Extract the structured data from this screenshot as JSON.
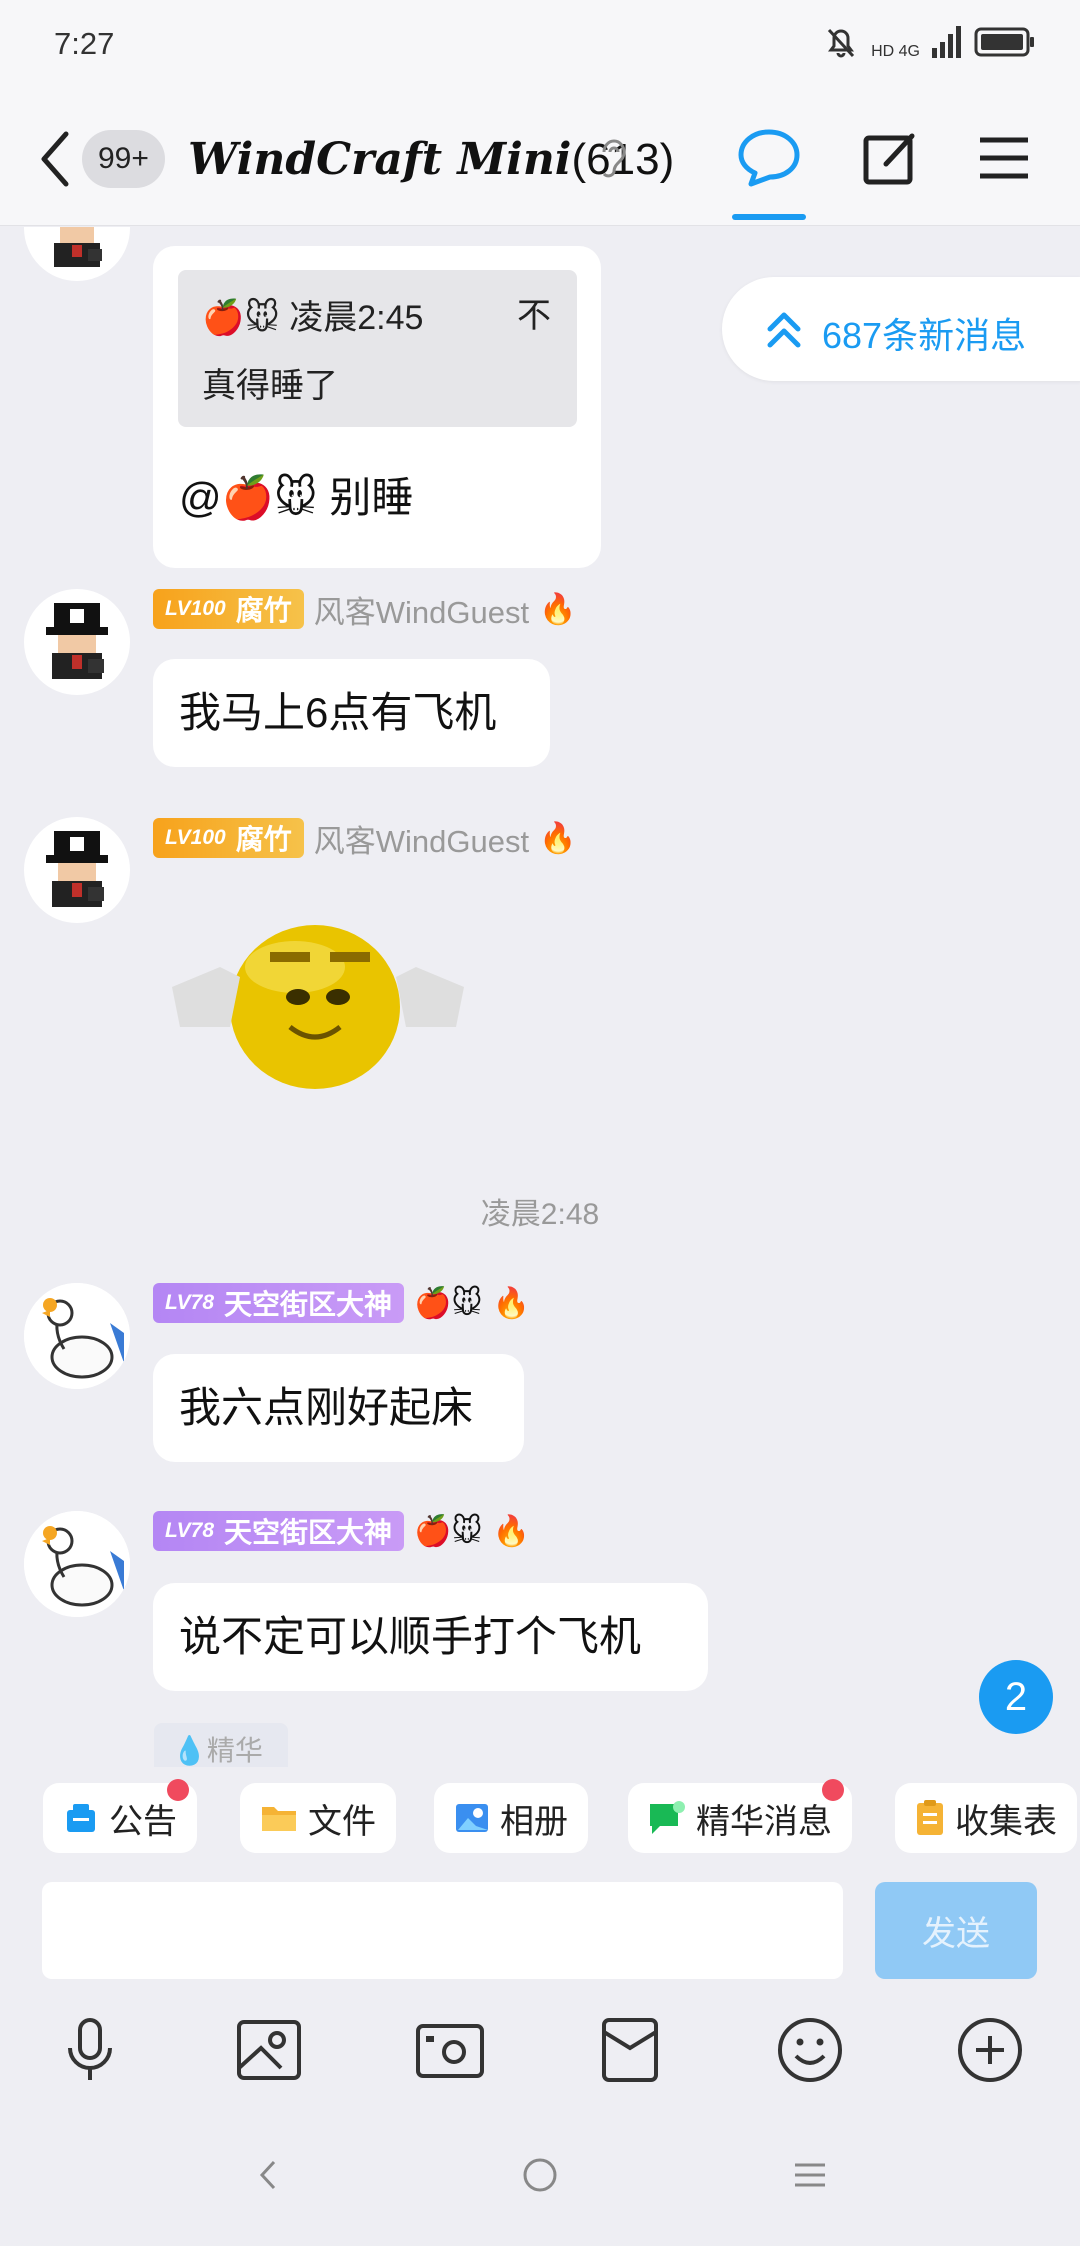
{
  "status_bar": {
    "time": "7:27",
    "network": "HD 4G"
  },
  "header": {
    "unread_badge": "99+",
    "title": "WindCraft Mini",
    "member_count": "(613)"
  },
  "new_messages": "687条新消息",
  "messages": [
    {
      "quote_sender_time": "🍎🐭 凌晨2:45",
      "quote_more": "不",
      "quote_text": "真得睡了",
      "text": "@🍎🐭 别睡"
    },
    {
      "level": "LV100",
      "title_tag": "腐竹",
      "nickname": "风客WindGuest",
      "badge": "🔥",
      "text": "我马上6点有飞机"
    },
    {
      "level": "LV100",
      "title_tag": "腐竹",
      "nickname": "风客WindGuest",
      "badge": "🔥",
      "sticker": "smiling-hands-emoji-sticker"
    },
    {
      "level": "LV78",
      "title_tag": "天空街区大神",
      "nickname": "🍎🐭",
      "badge": "🔥",
      "text": "我六点刚好起床"
    },
    {
      "level": "LV78",
      "title_tag": "天空街区大神",
      "nickname": "🍎🐭",
      "badge": "🔥",
      "text": "说不定可以顺手打个飞机"
    }
  ],
  "time_separator": "凌晨2:48",
  "unread_count": "2",
  "essence_chip": "精华",
  "shortcuts": [
    {
      "label": "公告",
      "icon": "announcement-icon",
      "dot": true
    },
    {
      "label": "文件",
      "icon": "folder-icon",
      "dot": false
    },
    {
      "label": "相册",
      "icon": "album-icon",
      "dot": false
    },
    {
      "label": "精华消息",
      "icon": "essence-icon",
      "dot": true
    },
    {
      "label": "收集表",
      "icon": "form-icon",
      "dot": false
    }
  ],
  "input": {
    "value": "",
    "placeholder": ""
  },
  "send_label": "发送",
  "colors": {
    "accent": "#1a9bf2",
    "background": "#eeeef3",
    "send_disabled": "#90c9f5",
    "dot": "#f04a5e"
  }
}
